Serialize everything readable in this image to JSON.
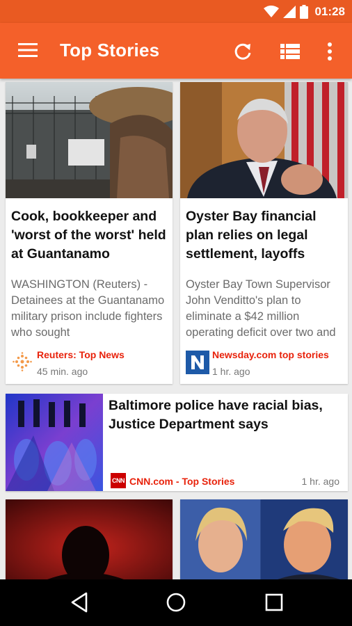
{
  "status_bar": {
    "time": "01:28"
  },
  "app_bar": {
    "title": "Top Stories"
  },
  "articles": [
    {
      "headline": "Cook, bookkeeper and 'worst of the worst' held at Guantanamo",
      "snippet": "WASHINGTON (Reuters) - Detainees at the Guantanamo military prison include fighters who sought",
      "source": "Reuters: Top News",
      "time": "45 min. ago"
    },
    {
      "headline": "Oyster Bay financial plan relies on legal settlement, layoffs",
      "snippet": "Oyster Bay Town Supervisor John Venditto's plan to eliminate a $42 million operating deficit over two and a half",
      "source": "Newsday.com top stories",
      "time": "1 hr. ago"
    },
    {
      "headline": "Baltimore police have racial bias, Justice Department says",
      "source": "CNN.com - Top Stories",
      "time": "1 hr. ago",
      "logo_text": "CNN"
    }
  ],
  "colors": {
    "accent": "#f4602a",
    "status": "#e95a22",
    "source_red": "#e8220b"
  }
}
